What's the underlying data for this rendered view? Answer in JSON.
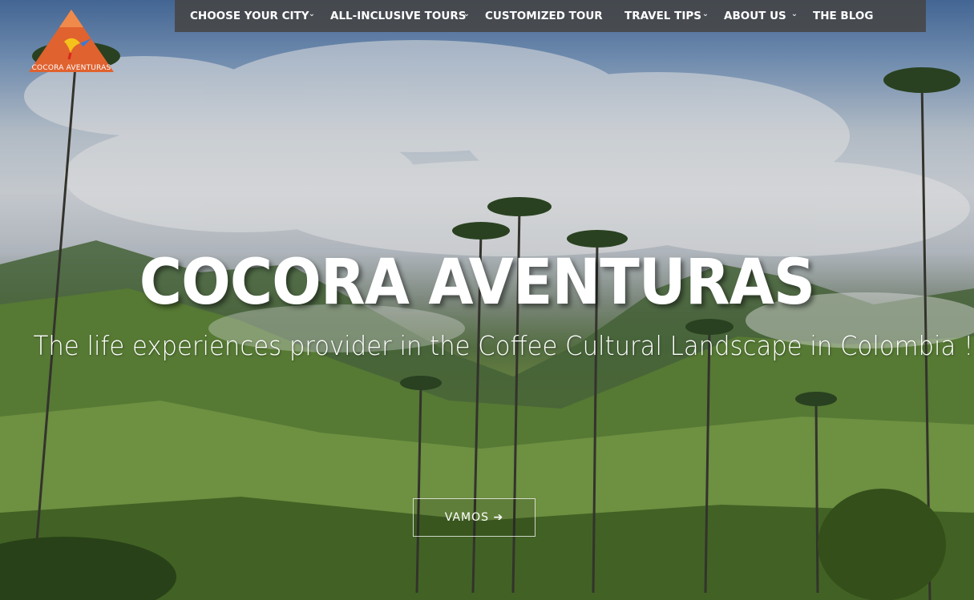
{
  "logo": {
    "alt_text": "COCORA AVENTURAS",
    "colors": {
      "mountain": "#e0622f",
      "bird": "#f4c21b"
    }
  },
  "nav": {
    "items": [
      {
        "label": "CHOOSE YOUR CITY",
        "has_dropdown": true
      },
      {
        "label": "ALL-INCLUSIVE TOURS",
        "has_dropdown": true
      },
      {
        "label": "CUSTOMIZED TOUR",
        "has_dropdown": false
      },
      {
        "label": "TRAVEL TIPS",
        "has_dropdown": true
      },
      {
        "label": "ABOUT US",
        "has_dropdown": true
      },
      {
        "label": "THE BLOG",
        "has_dropdown": false
      }
    ],
    "background": "#464646"
  },
  "hero": {
    "title": "COCORA AVENTURAS",
    "subtitle": "The life experiences provider in the Coffee Cultural Landscape in Colombia !",
    "cta_label": "VAMOS ➔"
  }
}
